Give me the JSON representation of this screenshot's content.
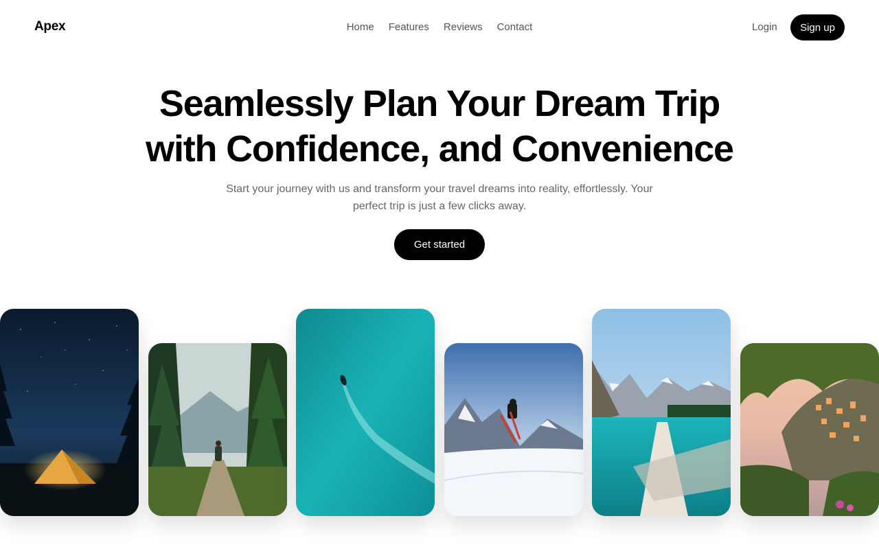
{
  "header": {
    "logo": "Apex",
    "nav": [
      "Home",
      "Features",
      "Reviews",
      "Contact"
    ],
    "login_label": "Login",
    "signup_label": "Sign up"
  },
  "hero": {
    "title_line1": "Seamlessly Plan Your Dream Trip",
    "title_line2": "with Confidence, and Convenience",
    "subtitle_line1": "Start your journey with us and transform your travel dreams into reality, effortlessly. Your",
    "subtitle_line2": "perfect trip is just a few clicks away.",
    "cta_label": "Get started"
  },
  "gallery": {
    "images": [
      "night-camping-tent",
      "forest-hiking-trail",
      "turquoise-sea-boat",
      "snow-mountain-skier",
      "mountain-lake-log",
      "coastal-cliff-village"
    ]
  },
  "colors": {
    "primary": "#000000",
    "text_muted": "#666666",
    "nav_text": "#555555",
    "background": "#ffffff"
  }
}
